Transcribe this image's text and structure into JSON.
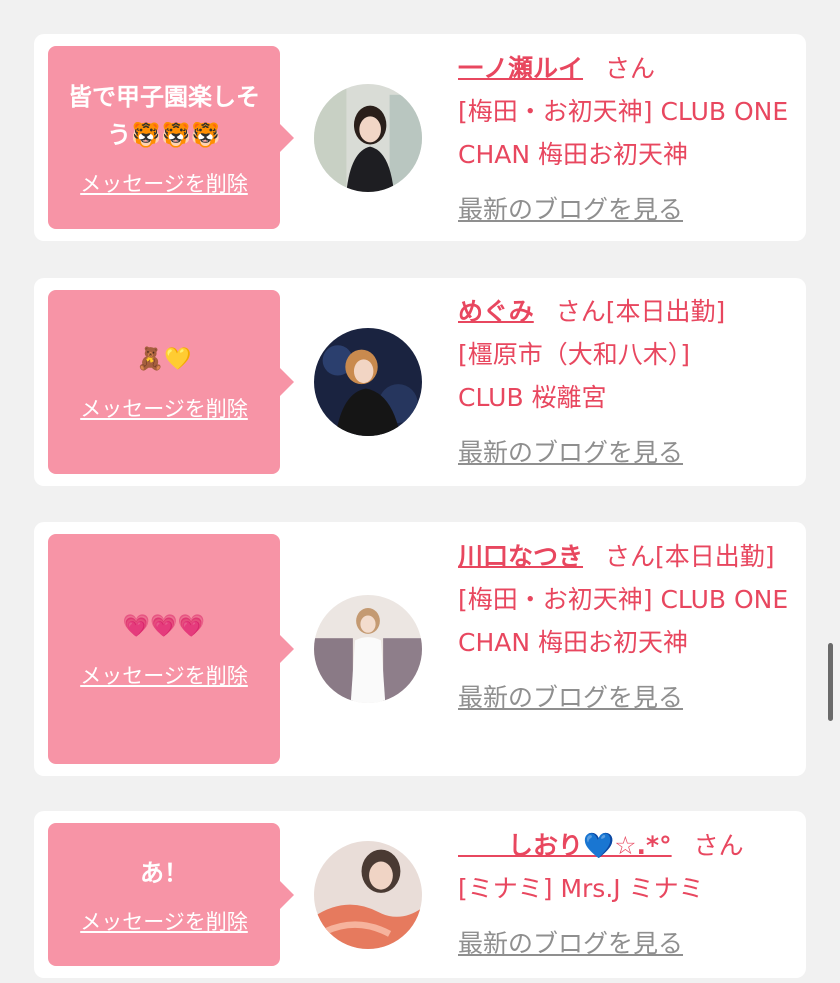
{
  "cards": [
    {
      "message": "皆で甲子園楽しそう🐯🐯🐯",
      "delete_label": "メッセージを削除",
      "name": "一ノ瀬ルイ",
      "honorific": "さん",
      "status": "",
      "shop": "[梅田・お初天神] CLUB ONE CHAN 梅田お初天神",
      "blog_label": "最新のブログを見る"
    },
    {
      "message": "🧸💛",
      "delete_label": "メッセージを削除",
      "name": "めぐみ",
      "honorific": "さん",
      "status": "[本日出勤]",
      "shop": "[橿原市（大和八木）] CLUB 桜離宮",
      "blog_label": "最新のブログを見る"
    },
    {
      "message": "💗💗💗",
      "delete_label": "メッセージを削除",
      "name": "川口なつき",
      "honorific": "さん",
      "status": "[本日出勤]",
      "shop": "[梅田・お初天神] CLUB ONE CHAN 梅田お初天神",
      "blog_label": "最新のブログを見る"
    },
    {
      "message": "あ！",
      "delete_label": "メッセージを削除",
      "name": "　　しおり💙☆.*°",
      "honorific": "さん",
      "status": "",
      "shop": "[ミナミ] Mrs.J ミナミ",
      "blog_label": "最新のブログを見る"
    }
  ],
  "colors": {
    "bubble": "#f794a6",
    "accent": "#e8475f",
    "link_gray": "#8f8f8f",
    "background": "#f1f1f1"
  }
}
